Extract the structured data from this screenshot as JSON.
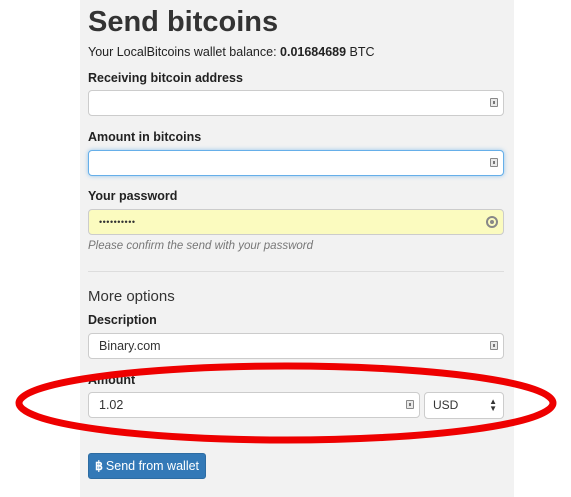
{
  "page": {
    "title": "Send bitcoins",
    "balance_prefix": "Your LocalBitcoins wallet balance: ",
    "balance_value": "0.01684689",
    "balance_unit": " BTC"
  },
  "form": {
    "receiving_label": "Receiving bitcoin address",
    "receiving_value": "",
    "amount_btc_label": "Amount in bitcoins",
    "amount_btc_value": "",
    "password_label": "Your password",
    "password_value": "••••••••••",
    "password_hint": "Please confirm the send with your password"
  },
  "more_options": {
    "heading": "More options",
    "description_label": "Description",
    "description_value": "Binary.com",
    "amount_label": "Amount",
    "amount_value": "1.02",
    "currency_selected": "USD",
    "currency_arrows": "▲\n▼"
  },
  "submit": {
    "icon_glyph": "฿",
    "label": "Send from wallet"
  },
  "colors": {
    "panel_bg": "#f2f2f2",
    "password_bg": "#fbfbbf",
    "button_bg": "#3379b7",
    "annotation_red": "#ee0000"
  },
  "icons": {
    "field": "field-autofill-icon",
    "password": "key-icon",
    "button": "bitcoin-icon"
  }
}
